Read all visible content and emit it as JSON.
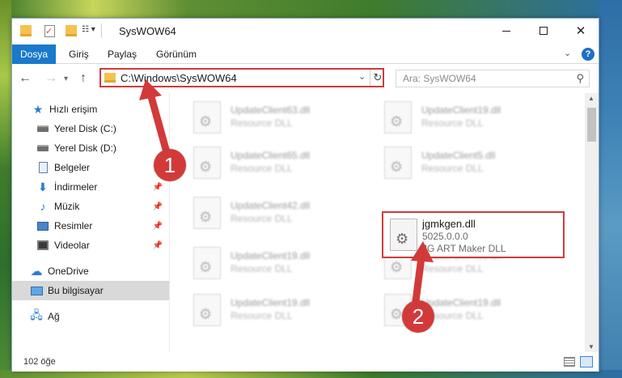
{
  "window": {
    "title": "SysWOW64"
  },
  "ribbon": {
    "tabs": [
      "Dosya",
      "Giriş",
      "Paylaş",
      "Görünüm"
    ],
    "help": "?"
  },
  "navbar": {
    "address": "C:\\Windows\\SysWOW64",
    "search_placeholder": "Ara: SysWOW64"
  },
  "sidebar": {
    "items": [
      {
        "label": "Hızlı erişim",
        "icon": "star-icon"
      },
      {
        "label": "Yerel Disk (C:)",
        "icon": "disk-icon"
      },
      {
        "label": "Yerel Disk (D:)",
        "icon": "disk-icon"
      },
      {
        "label": "Belgeler",
        "icon": "documents-icon",
        "pinned": true
      },
      {
        "label": "İndirmeler",
        "icon": "download-icon",
        "pinned": true
      },
      {
        "label": "Müzik",
        "icon": "music-icon",
        "pinned": true
      },
      {
        "label": "Resimler",
        "icon": "pictures-icon",
        "pinned": true
      },
      {
        "label": "Videolar",
        "icon": "video-icon",
        "pinned": true
      },
      {
        "label": "OneDrive",
        "icon": "cloud-icon"
      },
      {
        "label": "Bu bilgisayar",
        "icon": "computer-icon",
        "selected": true
      },
      {
        "label": "Ağ",
        "icon": "network-icon"
      }
    ]
  },
  "files": {
    "left_column": [
      {
        "name": "UpdateClient63.dll",
        "desc": "Resource DLL"
      },
      {
        "name": "UpdateClient65.dll",
        "desc": "Resource DLL"
      },
      {
        "name": "UpdateClient42.dll",
        "desc": "Resource DLL"
      },
      {
        "name": "UpdateClient19.dll",
        "desc": "Resource DLL"
      },
      {
        "name": "UpdateClient19.dll",
        "desc": "Resource DLL"
      }
    ],
    "right_column": [
      {
        "name": "UpdateClient19.dll",
        "desc": "Resource DLL"
      },
      {
        "name": "UpdateClient5.dll",
        "desc": "Resource DLL"
      },
      {
        "name": "UpdateClient63.dll",
        "desc": "Resource DLL"
      },
      {
        "name": "UpdateClient19.dll",
        "desc": "Resource DLL"
      }
    ],
    "highlighted": {
      "name": "jgmkgen.dll",
      "version": "5025.0.0.0",
      "desc": "JG ART Maker DLL"
    }
  },
  "status": {
    "count": "102 öğe"
  },
  "annotations": {
    "step1": "1",
    "step2": "2",
    "color": "#d23a3a"
  }
}
